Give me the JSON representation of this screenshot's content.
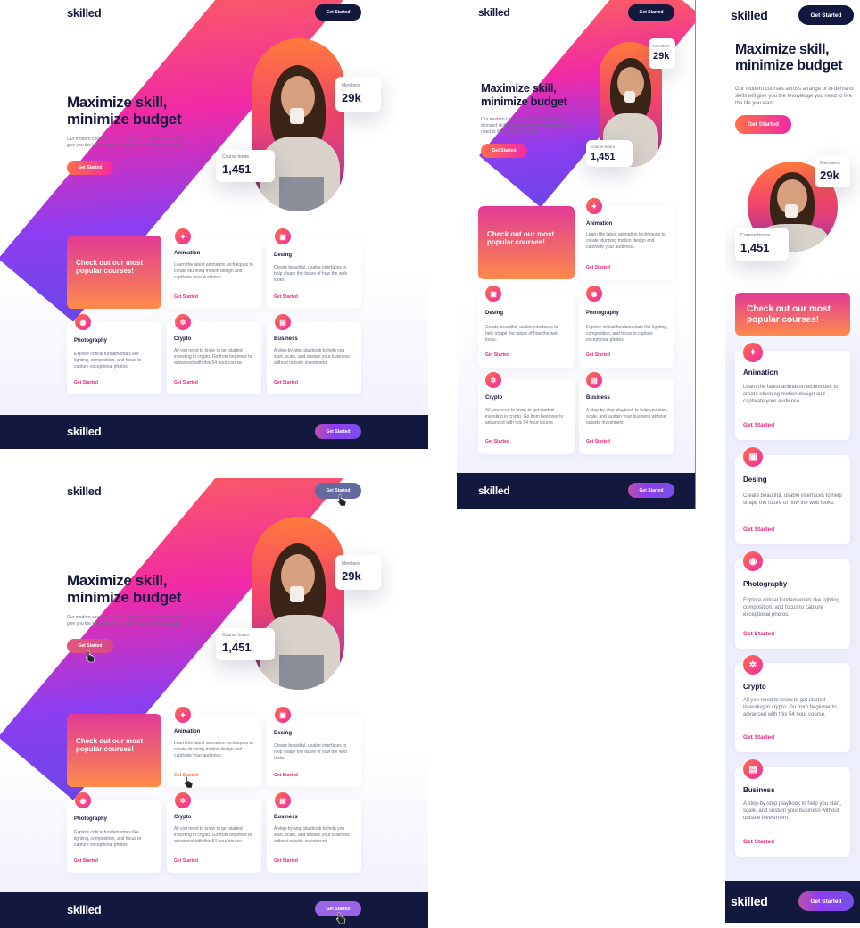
{
  "brand": "skilled",
  "nav": {
    "cta_label": "Get Started"
  },
  "hero": {
    "title_line1": "Maximize skill,",
    "title_line2": "minimize budget",
    "description": "Our modern courses across a range of in-demand skills will give you the knowledge you need to live the life you want.",
    "cta_label": "Get Started"
  },
  "stats": {
    "members_label": "Members",
    "members_value": "29k",
    "hours_label": "Course hours",
    "hours_value": "1,451"
  },
  "promo": {
    "text": "Check out our most popular courses!"
  },
  "courses": [
    {
      "title": "Animation",
      "description": "Learn the latest animation techniques to create stunning motion design and captivate your audience.",
      "link": "Get Started",
      "icon": "running-icon"
    },
    {
      "title": "Desing",
      "description": "Create beautiful, usable interfaces to help shape the future of how the web looks.",
      "link": "Get Started",
      "icon": "design-icon"
    },
    {
      "title": "Photography",
      "description": "Explore critical fundamentals like lighting, composition, and focus to capture exceptional photos.",
      "link": "Get Started",
      "icon": "camera-icon"
    },
    {
      "title": "Crypto",
      "description": "All you need to know to get started investing in crypto. Go from beginner to advanced with this 54 hour course.",
      "link": "Get Started",
      "icon": "crypto-icon"
    },
    {
      "title": "Business",
      "description": "A step-by-step playbook to help you start, scale, and sustain your business without outside investment.",
      "link": "Get Started",
      "icon": "briefcase-icon"
    }
  ],
  "footer": {
    "cta_label": "Get Started"
  },
  "colors": {
    "navy": "#13183f",
    "pink": "#f02aa6",
    "orange": "#ff6f48",
    "purple": "#8c3ef0",
    "link": "#e8267c"
  }
}
